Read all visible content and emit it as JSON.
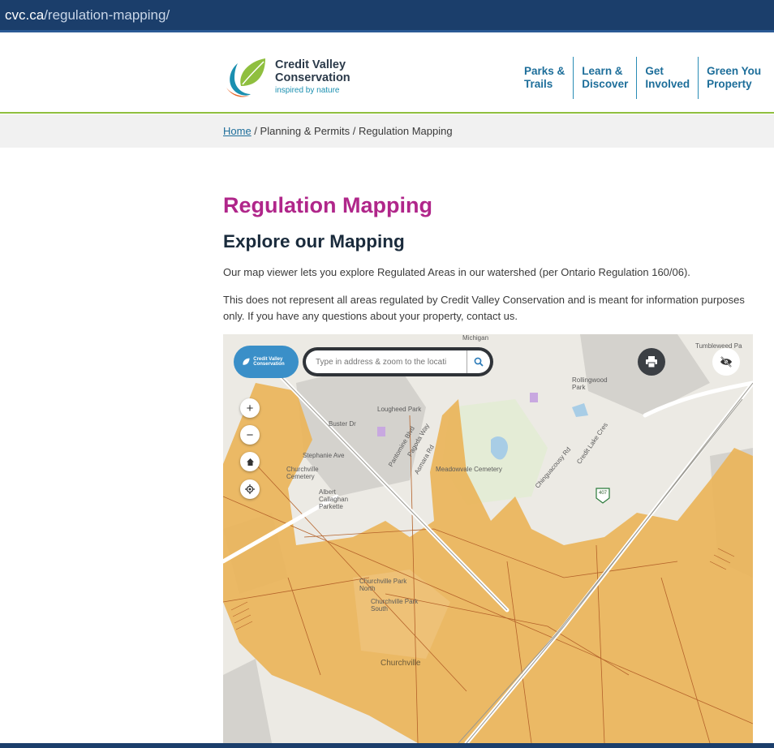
{
  "browser": {
    "url_domain": "cvc.ca",
    "url_path": "/regulation-mapping/"
  },
  "brand": {
    "name_line1": "Credit Valley",
    "name_line2": "Conservation",
    "tagline": "inspired by nature"
  },
  "nav": [
    {
      "line1": "Parks &",
      "line2": "Trails"
    },
    {
      "line1": "Learn &",
      "line2": "Discover"
    },
    {
      "line1": "Get",
      "line2": "Involved"
    },
    {
      "line1": "Green You",
      "line2": "Property"
    }
  ],
  "breadcrumb": {
    "home": "Home",
    "sep1": " / ",
    "section": "Planning & Permits",
    "sep2": " / ",
    "current": "Regulation Mapping"
  },
  "page": {
    "title": "Regulation Mapping",
    "subtitle": "Explore our Mapping",
    "para1": "Our map viewer lets you explore Regulated Areas in our watershed (per Ontario Regulation 160/06).",
    "para2": "This does not represent all areas regulated by Credit Valley Conservation and is meant for information purposes only. If you have any questions about your property, contact us."
  },
  "map": {
    "brand_label": "Credit Valley Conservation",
    "search_placeholder": "Type in address & zoom to the locati",
    "controls": {
      "zoom_in": "+",
      "zoom_out": "−"
    },
    "labels": {
      "michigan": "Michigan",
      "lougheed": "Lougheed Park",
      "buster": "Buster Dr",
      "stephanie": "Stephanie Ave",
      "churchville_cem": "Churchville Cemetery",
      "albert": "Albert Callaghan Parkette",
      "meadowvale": "Meadowvale Cemetery",
      "rollingwood": "Rollingwood Park",
      "tumbleweed": "Tumbleweed Pa",
      "churchville_north": "Churchville Park North",
      "churchville_south": "Churchville Park South",
      "churchville": "Churchville",
      "hwy": "407",
      "chinguacousy": "Chinguacousy Rd",
      "credit_lake": "Credit Lake Cres",
      "pantomine": "Pantomine Blvd",
      "pagoda": "Pagoda Way",
      "asmara": "Asmara Rd"
    },
    "colors": {
      "regulated": "#eab45a",
      "regulated_line": "#b4622a",
      "base": "#eceae4",
      "road": "#ffffff"
    }
  }
}
